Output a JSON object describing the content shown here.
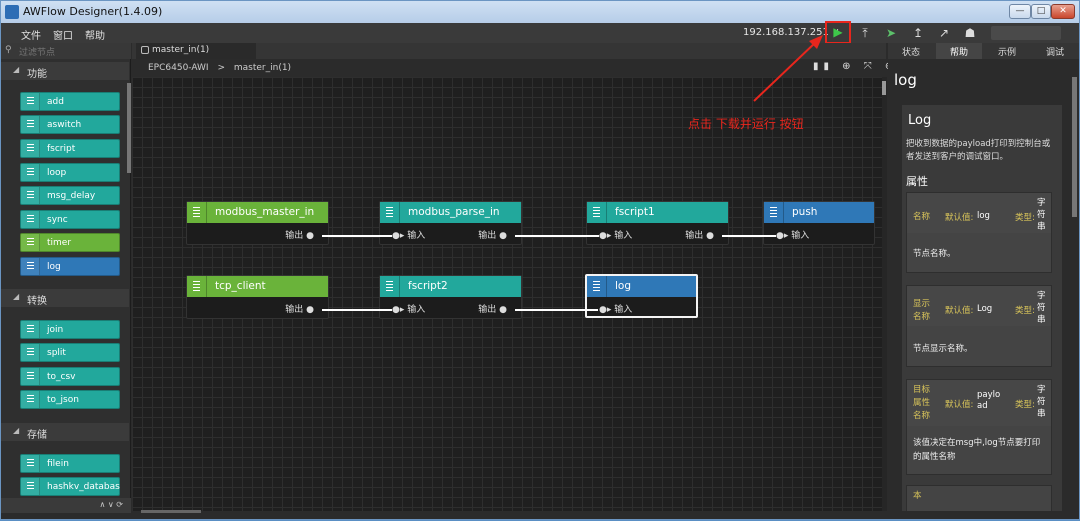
{
  "window": {
    "title": "AWFlow Designer(1.4.09)",
    "min": "—",
    "max": "□",
    "close": "✕"
  },
  "menu": [
    "文件",
    "窗口",
    "帮助"
  ],
  "toolbar": {
    "ip": "192.168.137.251 ∨",
    "run_icon": "▶",
    "upload_icon": "⤒",
    "deploy_icon": "➤",
    "export_icon": "↥",
    "share_icon": "↗",
    "user_icon": "☗"
  },
  "palette": {
    "search_placeholder": "过滤节点",
    "categories": [
      {
        "label": "功能",
        "nodes": [
          "add",
          "aswitch",
          "fscript",
          "loop",
          "msg_delay",
          "sync",
          "timer",
          "log"
        ]
      },
      {
        "label": "转换",
        "nodes": [
          "join",
          "split",
          "to_csv",
          "to_json"
        ]
      },
      {
        "label": "存储",
        "nodes": [
          "filein",
          "hashkv_databas"
        ]
      }
    ],
    "footer": "∧ ∨ ⟳"
  },
  "workspace": {
    "tab": "master_in(1)",
    "breadcrumb": [
      "EPC6450-AWI",
      ">",
      "master_in(1)"
    ],
    "zoom_tools": "▮▮ ⊕ ⤧ ⊖",
    "nodes": [
      {
        "name": "modbus_master_in",
        "out": "输出 ●",
        "in": ""
      },
      {
        "name": "modbus_parse_in",
        "out": "输出 ●",
        "in": "●▸ 输入"
      },
      {
        "name": "fscript1",
        "out": "输出 ●",
        "in": "●▸ 输入"
      },
      {
        "name": "push",
        "out": "",
        "in": "●▸ 输入"
      },
      {
        "name": "tcp_client",
        "out": "输出 ●",
        "in": ""
      },
      {
        "name": "fscript2",
        "out": "输出 ●",
        "in": "●▸ 输入"
      },
      {
        "name": "log",
        "out": "",
        "in": "●▸ 输入"
      }
    ],
    "hint": "点击 下载并运行 按钮"
  },
  "right": {
    "tabs": [
      "状态",
      "帮助",
      "示例",
      "调试"
    ],
    "title": "log",
    "heading": "Log",
    "desc": "把收到数据的payload打印到控制台或者发送到客户的调试窗口。",
    "props_label": "属性",
    "props": [
      {
        "name": "名称",
        "default_label": "默认值:",
        "default": "log",
        "type_label": "类型:",
        "type": "字符串",
        "desc": "节点名称。"
      },
      {
        "name": "显示名称",
        "default_label": "默认值:",
        "default": "Log",
        "type_label": "类型:",
        "type": "字符串",
        "desc": "节点显示名称。"
      },
      {
        "name": "目标属性名称",
        "default_label": "默认值:",
        "default": "payload",
        "type_label": "类型:",
        "type": "字符串",
        "desc": "该值决定在msg中,log节点要打印的属性名称"
      },
      {
        "name": "本",
        "default_label": "",
        "default": "",
        "type_label": "",
        "type": "",
        "desc": ""
      }
    ]
  },
  "colors": {
    "accent_run": "#3ec84a",
    "highlight": "#e8261d",
    "teal": "#22a89c",
    "green": "#6ab33a",
    "blue": "#2f78b7"
  }
}
